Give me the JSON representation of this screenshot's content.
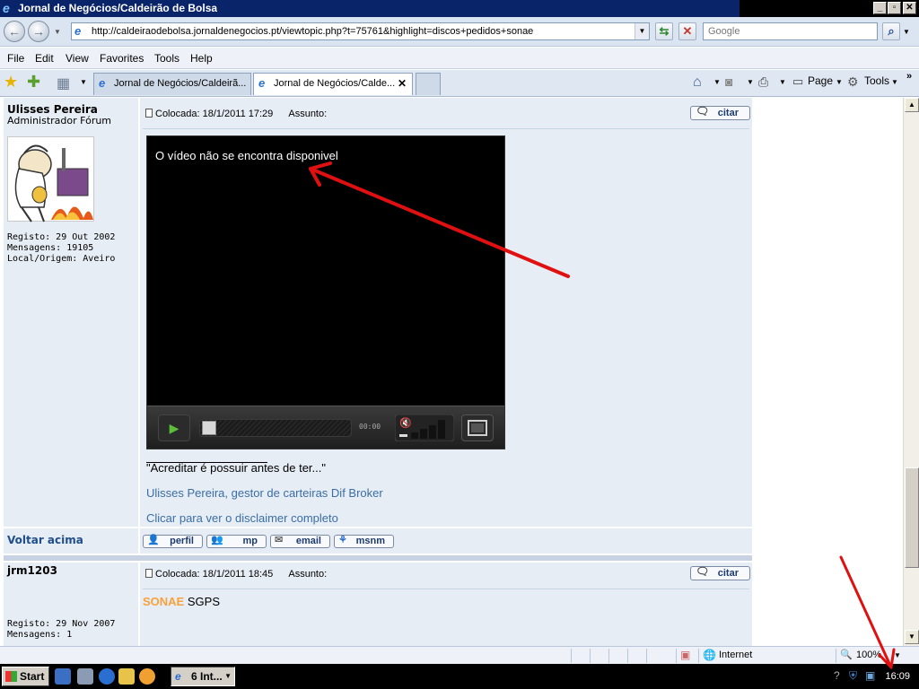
{
  "window": {
    "title": "Jornal de Negócios/Caldeirão de Bolsa -",
    "controls": {
      "minimize": "_",
      "maximize": "▫",
      "close": "✕"
    }
  },
  "navigation": {
    "url": "http://caldeiraodebolsa.jornaldenegocios.pt/viewtopic.php?t=75761&highlight=discos+pedidos+sonae",
    "search_placeholder": "Google"
  },
  "menu": [
    "File",
    "Edit",
    "View",
    "Favorites",
    "Tools",
    "Help"
  ],
  "tabs": [
    {
      "label": "Jornal de Negócios/Caldeirã...",
      "active": false
    },
    {
      "label": "Jornal de Negócios/Calde...",
      "active": true
    }
  ],
  "command_bar": {
    "page": "Page",
    "tools": "Tools"
  },
  "posts": [
    {
      "author": "Ulisses Pereira",
      "rank": "Administrador Fórum",
      "meta": "Registo: 29 Out 2002\nMensagens: 19105\nLocal/Origem: Aveiro",
      "posted": "Colocada: 18/1/2011 17:29",
      "subject_label": "Assunto:",
      "quote_label": "citar",
      "video_message": "O vídeo não se encontra disponivel",
      "video_time": "00:00",
      "signature_quote": "\"Acreditar é possuir antes de ter...\"",
      "signature_line": "Ulisses Pereira, gestor de carteiras Dif Broker",
      "disclaimer": "Clicar para ver o disclaimer completo",
      "back_to_top": "Voltar acima",
      "profile_buttons": [
        "perfil",
        "mp",
        "email",
        "msnm"
      ]
    },
    {
      "author": "jrm1203",
      "meta": "Registo: 29 Nov 2007\nMensagens: 1",
      "posted": "Colocada: 18/1/2011 18:45",
      "subject_label": "Assunto:",
      "quote_label": "citar",
      "body_highlight": "SONAE",
      "body_rest": "SGPS"
    }
  ],
  "statusbar": {
    "zone": "Internet",
    "zoom": "100%"
  },
  "taskbar": {
    "start": "Start",
    "task": "6 Int...",
    "clock": "16:09"
  },
  "colors": {
    "link": "#3a6ea5",
    "highlight": "#f7a13c",
    "annotation": "#e01010",
    "post_bg": "#e7edf4"
  }
}
